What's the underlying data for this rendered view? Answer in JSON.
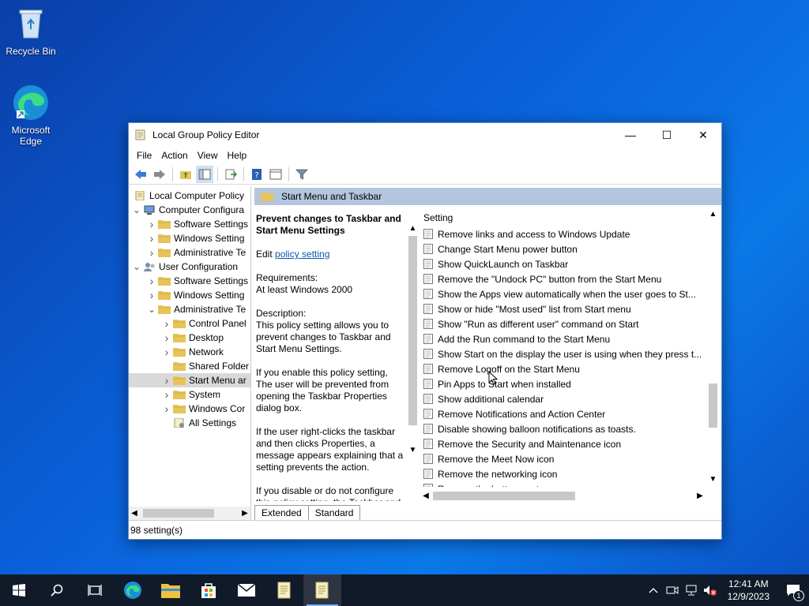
{
  "desktop": {
    "icons": [
      {
        "label": "Recycle Bin"
      },
      {
        "label": "Microsoft Edge"
      }
    ]
  },
  "window": {
    "title": "Local Group Policy Editor",
    "menu": [
      "File",
      "Action",
      "View",
      "Help"
    ]
  },
  "tree": {
    "items": [
      {
        "label": "Local Computer Policy"
      },
      {
        "label": "Computer Configura"
      },
      {
        "label": "Software Settings"
      },
      {
        "label": "Windows Setting"
      },
      {
        "label": "Administrative Te"
      },
      {
        "label": "User Configuration"
      },
      {
        "label": "Software Settings"
      },
      {
        "label": "Windows Setting"
      },
      {
        "label": "Administrative Te"
      },
      {
        "label": "Control Panel"
      },
      {
        "label": "Desktop"
      },
      {
        "label": "Network"
      },
      {
        "label": "Shared Folder"
      },
      {
        "label": "Start Menu ar"
      },
      {
        "label": "System"
      },
      {
        "label": "Windows Cor"
      },
      {
        "label": "All Settings"
      }
    ]
  },
  "pane": {
    "header": "Start Menu and Taskbar",
    "policy_title": "Prevent changes to Taskbar and Start Menu Settings",
    "edit_prefix": "Edit ",
    "edit_link": "policy setting ",
    "requirements_label": "Requirements:",
    "requirements_value": "At least Windows 2000",
    "description_label": "Description:",
    "description_1": "This policy setting allows you to prevent changes to Taskbar and Start Menu Settings.",
    "description_2": "If you enable this policy setting, The user will be prevented from opening the Taskbar Properties dialog box.",
    "description_3": "If the user right-clicks the taskbar and then clicks Properties, a message appears explaining that a setting prevents the action.",
    "description_4": "If you disable or do not configure this policy setting, the Taskbar and",
    "list_header": "Setting",
    "settings": [
      "Remove links and access to Windows Update",
      "Change Start Menu power button",
      "Show QuickLaunch on Taskbar",
      "Remove the \"Undock PC\" button from the Start Menu",
      "Show the Apps view automatically when the user goes to St...",
      "Show or hide \"Most used\" list from Start menu",
      "Show \"Run as different user\" command on Start",
      "Add the Run command to the Start Menu",
      "Show Start on the display the user is using when they press t...",
      "Remove Logoff on the Start Menu",
      "Pin Apps to Start when installed",
      "Show additional calendar",
      "Remove Notifications and Action Center",
      "Disable showing balloon notifications as toasts.",
      "Remove the Security and Maintenance icon",
      "Remove the Meet Now icon",
      "Remove the networking icon",
      "Remove the battery meter"
    ],
    "tabs": [
      "Extended",
      "Standard"
    ]
  },
  "status": {
    "text": "98 setting(s)"
  },
  "taskbar": {
    "time": "12:41 AM",
    "date": "12/9/2023",
    "notification_count": "1"
  }
}
